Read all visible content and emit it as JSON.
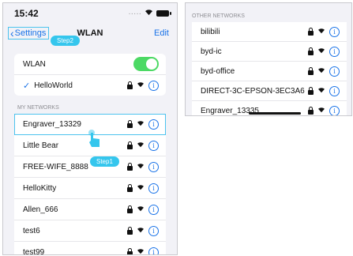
{
  "status": {
    "time": "15:42",
    "dots": "·····"
  },
  "nav": {
    "back_label": "Settings",
    "title": "WLAN",
    "edit_label": "Edit"
  },
  "wlan": {
    "label": "WLAN",
    "enabled": true,
    "connected_network": "HelloWorld"
  },
  "my_networks": {
    "header": "MY NETWORKS",
    "items": [
      "Engraver_13329",
      "Little Bear",
      "FREE-WIFE_8888",
      "HelloKitty",
      "Allen_666",
      "test6",
      "test99"
    ]
  },
  "other_networks": {
    "header": "OTHER NETWORKS",
    "items": [
      "bilibili",
      "byd-ic",
      "byd-office",
      "DIRECT-3C-EPSON-3EC3A6",
      "Engraver_13335"
    ]
  },
  "annotations": {
    "step1": "Step1",
    "step2": "Step2"
  },
  "icons": {
    "lock": "lock-icon",
    "wifi": "wifi-icon",
    "info": "info-icon"
  },
  "colors": {
    "accent": "#1a73e8",
    "toggle_on": "#4cd964",
    "annotation": "#35c6ed"
  }
}
